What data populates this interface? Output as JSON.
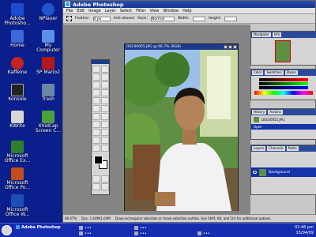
{
  "desktop": [
    {
      "id": "photoshop",
      "label": "Adobe\nPhotosho...",
      "color": "#1d4bd2"
    },
    {
      "id": "nplayer",
      "label": "NPlayer",
      "color": "#2255cc"
    },
    {
      "id": "home",
      "label": "Home",
      "color": "#3c6ad8"
    },
    {
      "id": "mycomputer",
      "label": "My\nComputer",
      "color": "#5d8fe8"
    },
    {
      "id": "kaffeine",
      "label": "Kaffeine",
      "color": "#c22323"
    },
    {
      "id": "spmario2",
      "label": "SP Mario2",
      "color": "#b01a1a"
    },
    {
      "id": "konsole",
      "label": "Konsole",
      "color": "#222"
    },
    {
      "id": "trash",
      "label": "Trash",
      "color": "#6b87a8"
    },
    {
      "id": "kwrite",
      "label": "KWrite",
      "color": "#d7d7d7"
    },
    {
      "id": "xvidcap",
      "label": "XVidCap\nScreen C...",
      "color": "#4ca23a"
    },
    {
      "id": "excel",
      "label": "Microsoft\nOffice Ex...",
      "color": "#2f7f2f"
    },
    {
      "id": "powerpoint",
      "label": "Microsoft\nOffice Po...",
      "color": "#c44b1b"
    },
    {
      "id": "word",
      "label": "Microsoft\nOffice W...",
      "color": "#1c4fb5"
    }
  ],
  "photoshop": {
    "title": "Adobe Photoshop",
    "menu": [
      "File",
      "Edit",
      "Image",
      "Layer",
      "Select",
      "Filter",
      "View",
      "Window",
      "Help"
    ],
    "options": {
      "feather_label": "Feather:",
      "feather_value": "0 px",
      "antialias_label": "Anti-aliased",
      "style_label": "Style:",
      "style_value": "Normal",
      "width_label": "Width:",
      "height_label": "Height:"
    },
    "document": {
      "title": "DSC00055.JPG @ 66.7% (RGB)"
    },
    "status": {
      "zoom": "66.67%",
      "doc": "Doc: 1.64M/1.64M",
      "hint": "Draw rectangular selection or move selection outline. Use Shift, Alt, and Ctrl for additional options."
    },
    "panels": {
      "navigator": [
        "Navigator",
        "Info"
      ],
      "color": [
        "Color",
        "Swatches",
        "Styles"
      ],
      "history": [
        "History",
        "Actions"
      ],
      "history_items": [
        "DSC00055.JPG",
        "Open"
      ],
      "layers": [
        "Layers",
        "Channels",
        "Paths"
      ],
      "layer_name": "Background"
    }
  },
  "taskbar": {
    "tasks": [
      {
        "label": "Adobe Photoshop",
        "active": true
      },
      {
        "label": "•••",
        "active": false
      },
      {
        "label": "•••",
        "active": false
      },
      {
        "label": "•••",
        "active": false
      },
      {
        "label": "•••",
        "active": false
      },
      {
        "label": "•••",
        "active": false
      }
    ],
    "time": "02:46 pm",
    "date": "15/04/09"
  },
  "colors": {
    "desktop": "#0b1f8c",
    "titlebar": "#1c3a8c",
    "highlight": "#1532a8"
  }
}
